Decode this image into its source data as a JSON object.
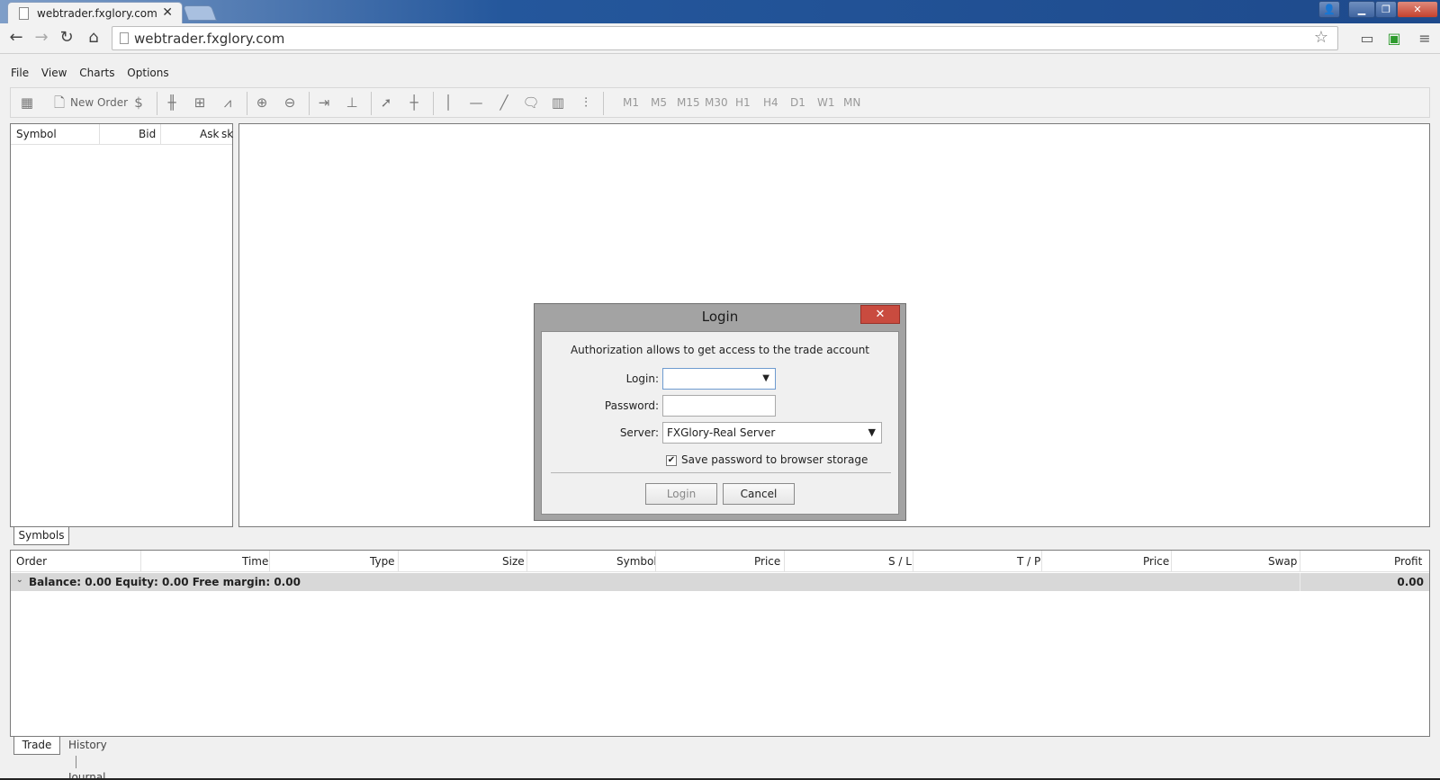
{
  "browser": {
    "tab_title": "webtrader.fxglory.com",
    "tab_close": "✕",
    "url": "webtrader.fxglory.com",
    "win_min": "▁",
    "win_max": "❐",
    "win_close": "✕"
  },
  "menu": {
    "file": "File",
    "view": "View",
    "charts": "Charts",
    "options": "Options"
  },
  "toolbar": {
    "new_order": "New Order",
    "timeframes": [
      "M1",
      "M5",
      "M15",
      "M30",
      "H1",
      "H4",
      "D1",
      "W1",
      "MN"
    ]
  },
  "symbols": {
    "col_symbol": "Symbol",
    "col_bid": "Bid",
    "col_ask": "Ask",
    "col_trunc": "sk",
    "tab": "Symbols"
  },
  "terminal": {
    "columns": [
      "Order",
      "Time",
      "Type",
      "Size",
      "Symbol",
      "Price",
      "S / L",
      "T / P",
      "Price",
      "Swap",
      "Profit"
    ],
    "balance_line": "Balance: 0.00  Equity: 0.00  Free margin: 0.00",
    "profit_total": "0.00",
    "tabs": {
      "trade": "Trade",
      "history": "History",
      "journal": "Journal"
    }
  },
  "login_dialog": {
    "title": "Login",
    "close": "✕",
    "info": "Authorization allows to get access to the trade account",
    "login_label": "Login:",
    "login_value": "",
    "password_label": "Password:",
    "password_value": "",
    "server_label": "Server:",
    "server_value": "FXGlory-Real Server",
    "save_checked": "✔",
    "save_label": "Save password to browser storage",
    "login_button": "Login",
    "cancel_button": "Cancel"
  }
}
